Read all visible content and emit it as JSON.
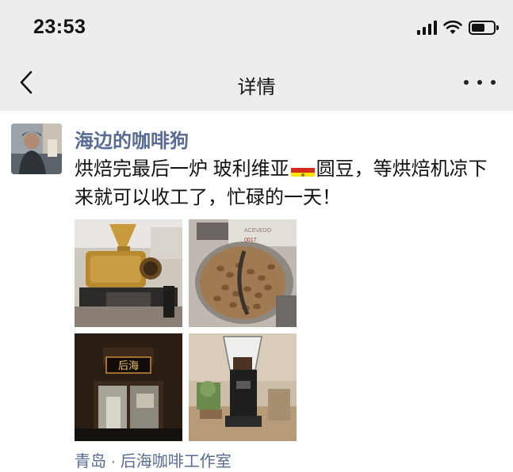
{
  "status_bar": {
    "time": "23:53"
  },
  "nav": {
    "title": "详情"
  },
  "post": {
    "author": "海边的咖啡狗",
    "text_part1": "烘焙完最后一炉 玻利维亚",
    "text_part2": "圆豆，等烘焙机凉下来就可以收工了，忙碌的一天！",
    "photos": [
      {
        "icon": "roaster-machine-photo"
      },
      {
        "icon": "roasted-beans-photo",
        "label": "ACEVEDO",
        "number": "0017"
      },
      {
        "icon": "shop-sign-photo",
        "sign_text": "后海"
      },
      {
        "icon": "coffee-grinder-photo"
      }
    ],
    "location": "青岛 · 后海咖啡工作室"
  },
  "colors": {
    "accent_link": "#576b95",
    "header_bg": "#ededed"
  }
}
